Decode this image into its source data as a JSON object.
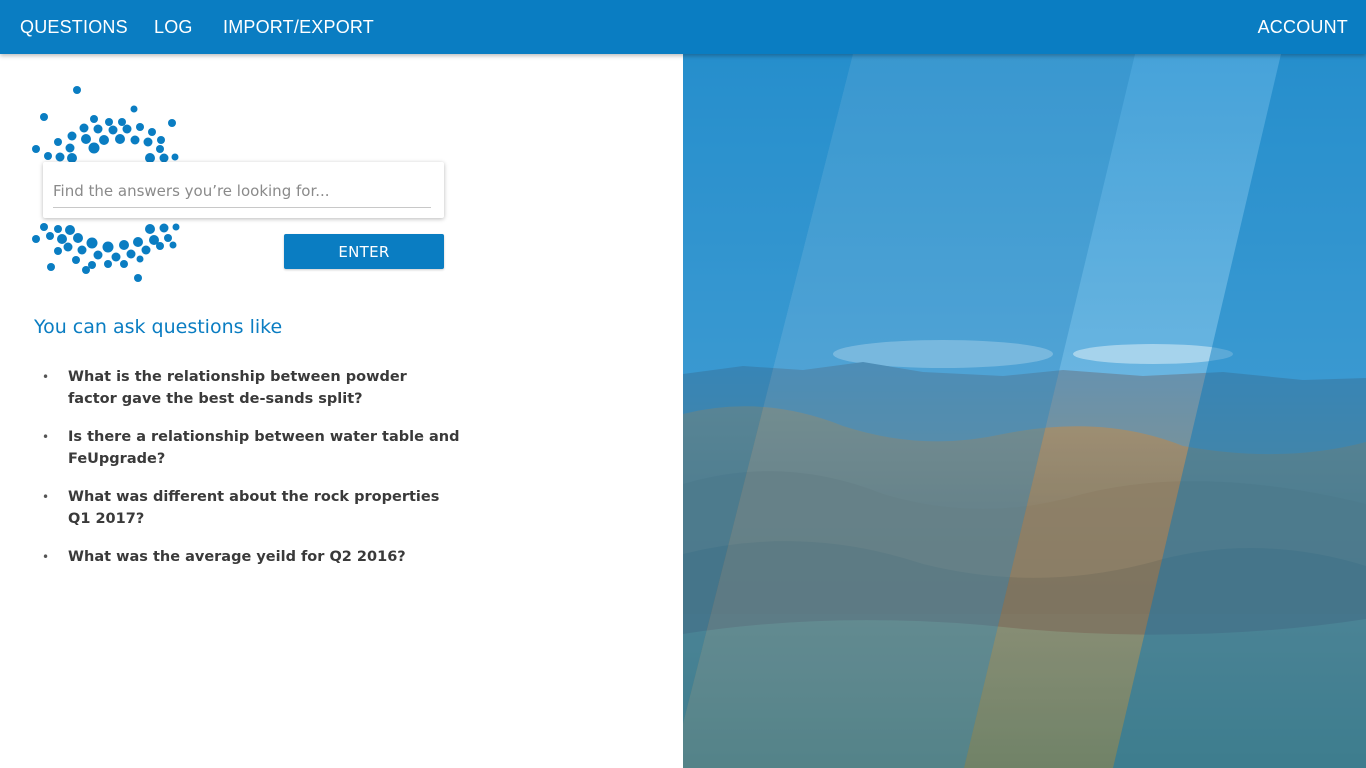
{
  "nav": {
    "questions": "QUESTIONS",
    "log": "LOG",
    "import_export": "IMPORT/EXPORT",
    "account": "ACCOUNT"
  },
  "search": {
    "placeholder": "Find the answers you’re looking for...",
    "value": "",
    "enter_label": "ENTER"
  },
  "examples": {
    "heading": "You can ask questions like",
    "items": [
      "What is the relationship between powder factor gave the best de-sands split?",
      "Is there a relationship between water table and FeUpgrade?",
      "What was different about the rock properties Q1 2017?",
      "What was the average yeild for Q2 2016?"
    ]
  },
  "colors": {
    "brand": "#0a7dc2",
    "text": "#3a3a3a"
  },
  "icons": {
    "logo": "dot-cluster-logo",
    "bullet": "bullet-dot"
  }
}
